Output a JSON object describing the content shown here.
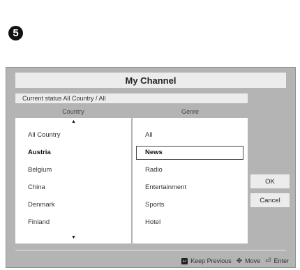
{
  "step_badge": "5",
  "dialog": {
    "title": "My Channel",
    "status": "Current status All Country / All",
    "country_header": "Country",
    "genre_header": "Genre",
    "countries": [
      "All Country",
      "Austria",
      "Belgium",
      "China",
      "Denmark",
      "Finland"
    ],
    "genres": [
      "All",
      "News",
      "Radio",
      "Entertainment",
      "Sports",
      "Hotel"
    ],
    "selected_country": "Austria",
    "selected_genre": "News",
    "ok_label": "OK",
    "cancel_label": "Cancel"
  },
  "footer": {
    "keep_previous_label": "Keep Previous",
    "move_label": "Move",
    "enter_label": "Enter"
  },
  "icons": {
    "scroll_up": "up-arrow-icon",
    "scroll_down": "down-arrow-icon",
    "keep_previous": "back-key-icon",
    "move": "directional-pad-icon",
    "enter": "enter-key-icon"
  }
}
